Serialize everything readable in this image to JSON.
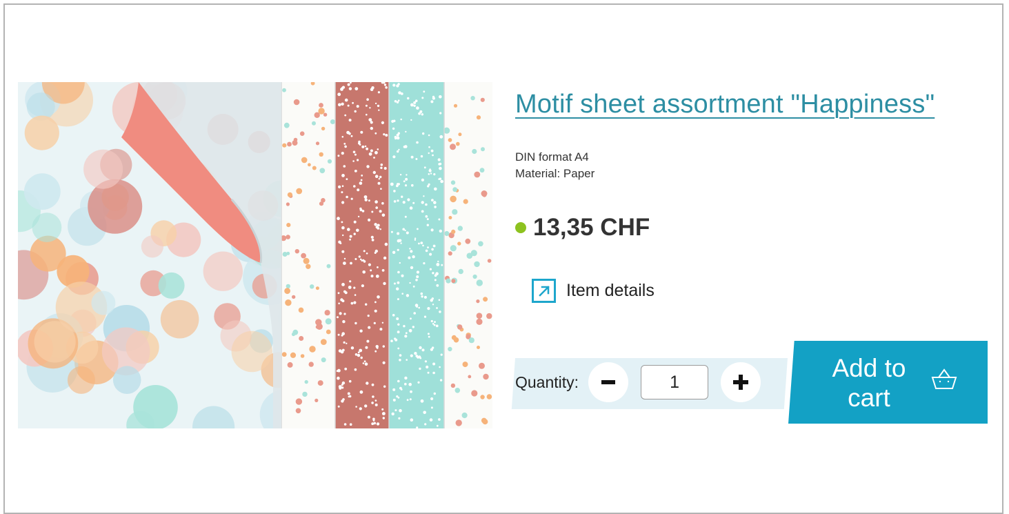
{
  "product": {
    "title": "Motif sheet assortment \"Happiness\"",
    "attributes": [
      "DIN format A4",
      "Material: Paper"
    ],
    "price": "13,35 CHF",
    "stock_color": "#8dc21f",
    "details_label": "Item details",
    "details_icon": "external-arrow-icon"
  },
  "cart": {
    "quantity_label": "Quantity:",
    "quantity_value": "1",
    "decrease_icon": "minus-icon",
    "increase_icon": "plus-icon",
    "add_label_line1": "Add to",
    "add_label_line2": "cart",
    "cart_icon": "basket-icon"
  },
  "colors": {
    "accent": "#13a1c5",
    "title": "#2d8ea3",
    "quantity_bar": "#e3f1f6"
  }
}
